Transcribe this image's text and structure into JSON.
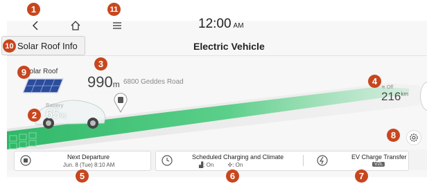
{
  "header": {
    "clock_time": "12:00",
    "clock_ampm": "AM",
    "page_title": "Electric Vehicle",
    "solar_roof_button": "Solar Roof Info"
  },
  "map": {
    "solar_roof_label": "Solar Roof",
    "distance_value": "990",
    "distance_unit": "m",
    "address": "6800 Geddes Road",
    "battery_label": "Battery",
    "battery_value": "65",
    "battery_unit": "%",
    "range_label": "≋ Off",
    "range_value": "216",
    "range_unit": "km"
  },
  "bottom": {
    "next_departure_title": "Next Departure",
    "next_departure_sub": "Jun. 8 (Tue) 8:10  AM",
    "scheduled_title": "Scheduled Charging and Climate",
    "scheduled_charge_status": ": On",
    "scheduled_climate_status": ": On",
    "ev_transfer_title": "EV Charge Transfer",
    "ev_transfer_badge": "V2L"
  },
  "callouts": {
    "c1": "1",
    "c2": "2",
    "c3": "3",
    "c4": "4",
    "c5": "5",
    "c6": "6",
    "c7": "7",
    "c8": "8",
    "c9": "9",
    "c10": "10",
    "c11": "11"
  },
  "icons": {
    "back": "back-icon",
    "home": "home-icon",
    "menu": "menu-icon",
    "settings": "gear-icon",
    "charging_pin": "charging-pin-icon"
  },
  "colors": {
    "callout": "#c8461e",
    "road_green": "#3fc070"
  }
}
